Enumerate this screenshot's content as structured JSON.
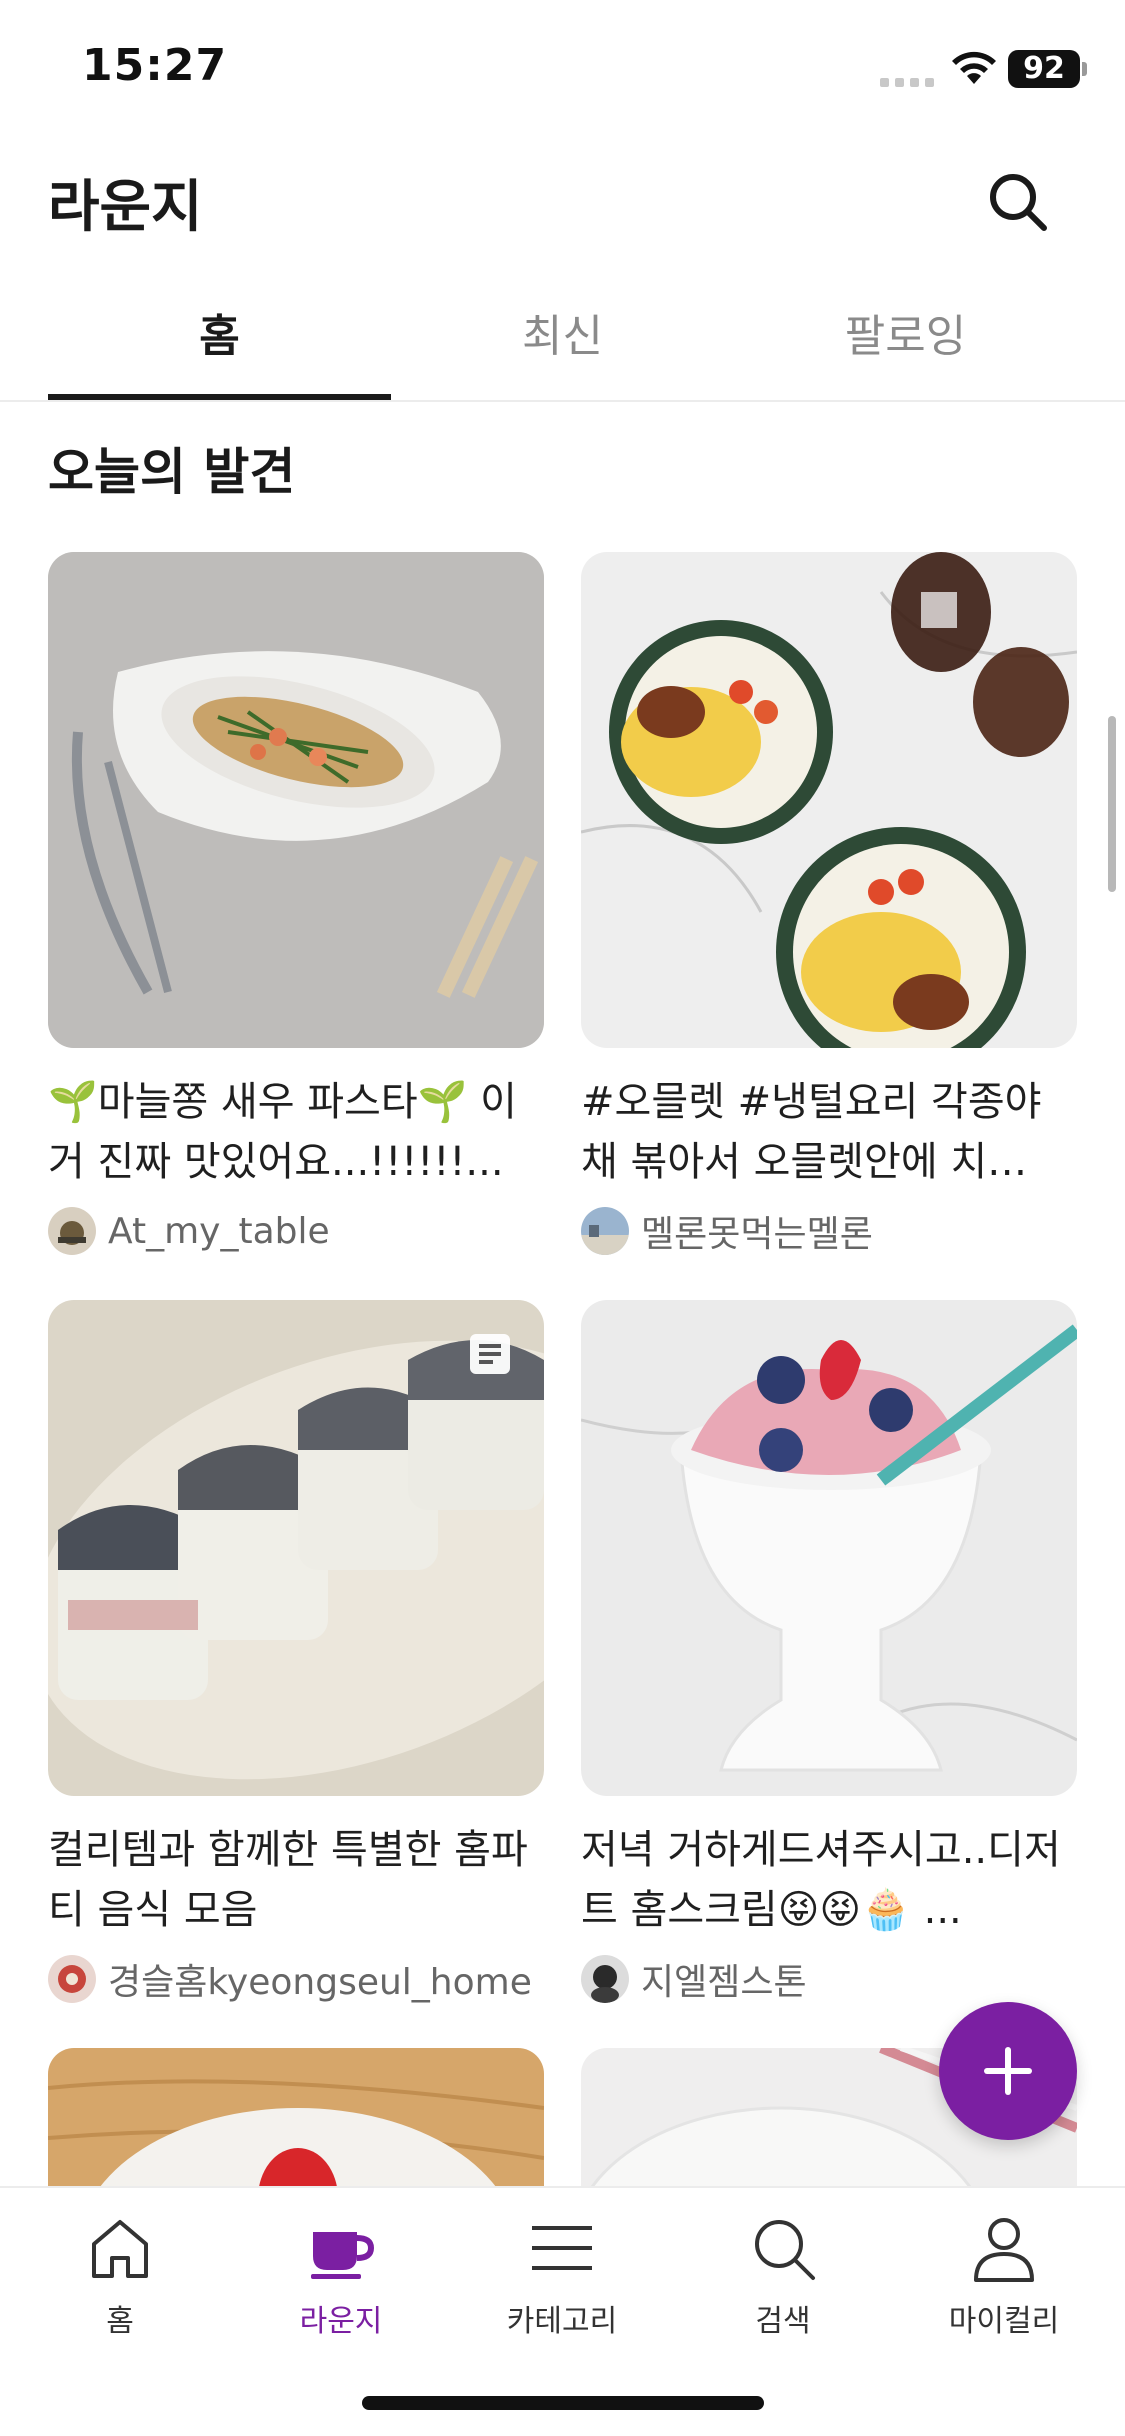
{
  "status_bar": {
    "time": "15:27",
    "battery": "92"
  },
  "header": {
    "title": "라운지",
    "search_icon": "search-icon"
  },
  "tabs": [
    {
      "label": "홈",
      "active": true
    },
    {
      "label": "최신",
      "active": false
    },
    {
      "label": "팔로잉",
      "active": false
    }
  ],
  "section": {
    "title": "오늘의 발견"
  },
  "cards": [
    {
      "text": "🌱마늘쫑 새우 파스타🌱 이거 진짜 맛있어요...!!!!!!...",
      "user": "At_my_table"
    },
    {
      "text": "#오믈렛 #냉털요리 각종야채 볶아서 오믈렛안에 치…",
      "user": "멜론못먹는멜론"
    },
    {
      "text": "컬리템과 함께한 특별한 홈파티 음식 모음",
      "user": "경슬홈kyeongseul_home"
    },
    {
      "text": "저녁  거하게드셔주시고..디저트 홈스크림😝😝🧁 ...",
      "user": "지엘젬스톤"
    }
  ],
  "fab": {
    "icon": "plus-icon"
  },
  "bottom_nav": [
    {
      "label": "홈",
      "icon": "home-icon",
      "active": false
    },
    {
      "label": "라운지",
      "icon": "coffee-cup-icon",
      "active": true
    },
    {
      "label": "카테고리",
      "icon": "menu-icon",
      "active": false
    },
    {
      "label": "검색",
      "icon": "search-icon",
      "active": false
    },
    {
      "label": "마이컬리",
      "icon": "person-icon",
      "active": false
    }
  ],
  "colors": {
    "accent": "#7b1fa2",
    "text": "#1a1a1a",
    "muted": "#8a8a8a"
  }
}
